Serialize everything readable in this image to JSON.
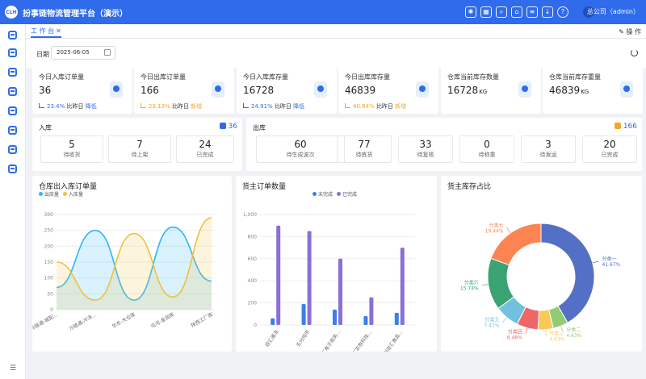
{
  "app": {
    "logo_text": "CLH",
    "title": "扮事链物流管理平台（演示）",
    "user": "总公司（admin）"
  },
  "header_icons": [
    "bug-icon",
    "grid-icon",
    "search-icon",
    "bank-icon",
    "document-icon",
    "download-icon",
    "help-icon"
  ],
  "sidebar": {
    "items": [
      "dashboard-icon",
      "box-icon",
      "truck-icon",
      "package-icon",
      "warehouse-icon",
      "list-icon",
      "report-icon",
      "settings-icon"
    ],
    "collapse_icon": "menu-fold-icon"
  },
  "tabs": [
    {
      "label": "工 作 台",
      "close": "✕"
    }
  ],
  "ops_label": "操 作",
  "filter": {
    "date_label": "日期",
    "date_value": "2025-06-05"
  },
  "stats": [
    {
      "label": "今日入库订单量",
      "value": "36",
      "unit": "",
      "change": "23.4%",
      "compare": "比昨日",
      "status": "降低",
      "color": "#2f6bea",
      "icon": "order-in-icon"
    },
    {
      "label": "今日出库订单量",
      "value": "166",
      "unit": "",
      "change": "23.13%",
      "compare": "比昨日",
      "status": "新增",
      "color": "#f5a623",
      "icon": "order-out-icon"
    },
    {
      "label": "今日入库库存量",
      "value": "16728",
      "unit": "",
      "change": "24.91%",
      "compare": "比昨日",
      "status": "降低",
      "color": "#2f6bea",
      "icon": "stock-in-icon"
    },
    {
      "label": "今日出库库存量",
      "value": "46839",
      "unit": "",
      "change": "40.84%",
      "compare": "比昨日",
      "status": "新增",
      "color": "#f5a623",
      "icon": "stock-out-icon"
    },
    {
      "label": "仓库当前库存数量",
      "value": "16728",
      "unit": "KG",
      "change": "",
      "compare": "",
      "status": "",
      "color": "#2f6bea",
      "icon": "warehouse-qty-icon"
    },
    {
      "label": "仓库当前库存重量",
      "value": "46839",
      "unit": "KG",
      "change": "",
      "compare": "",
      "status": "",
      "color": "#2f6bea",
      "icon": "warehouse-weight-icon"
    }
  ],
  "inbound": {
    "title": "入库",
    "count": "36",
    "items": [
      {
        "value": "5",
        "label": "待收货"
      },
      {
        "value": "7",
        "label": "待上架"
      },
      {
        "value": "24",
        "label": "已完成"
      }
    ]
  },
  "outbound": {
    "title": "出库",
    "count": "166",
    "items": [
      {
        "value": "60",
        "label": "待生成波次"
      },
      {
        "value": "77",
        "label": "待拣货"
      },
      {
        "value": "33",
        "label": "待复核"
      },
      {
        "value": "0",
        "label": "待称重"
      },
      {
        "value": "3",
        "label": "待发运"
      },
      {
        "value": "20",
        "label": "已完成"
      }
    ]
  },
  "chart_data": [
    {
      "type": "area",
      "title": "仓库出入库订单量",
      "categories": [
        "冷链通-城配…",
        "冷链通-冷冻…",
        "华东-大仓库",
        "屯河-金润库",
        "陕西工厂库"
      ],
      "series": [
        {
          "name": "出库量",
          "color": "#2db7f5",
          "values": [
            70,
            250,
            30,
            260,
            90
          ]
        },
        {
          "name": "入库量",
          "color": "#f0c040",
          "values": [
            150,
            30,
            240,
            40,
            290
          ]
        }
      ],
      "ylim": [
        0,
        300
      ],
      "yticks": [
        0,
        50,
        100,
        150,
        200,
        250,
        300
      ],
      "grid": true,
      "legend": "top-left"
    },
    {
      "type": "bar",
      "title": "货主订单数量",
      "categories": [
        "双汇速冻",
        "五分炖市",
        "双汇电子商务…",
        "双汇农牧科技…",
        "郑州双汇食品…"
      ],
      "series": [
        {
          "name": "未完成",
          "color": "#3b7fe8",
          "values": [
            60,
            190,
            140,
            80,
            110
          ]
        },
        {
          "name": "已完成",
          "color": "#8b6fd6",
          "values": [
            900,
            850,
            600,
            250,
            700
          ]
        }
      ],
      "ylim": [
        0,
        1000
      ],
      "yticks": [
        0,
        200,
        400,
        600,
        800,
        1000
      ],
      "ytick_labels": [
        "0",
        "200",
        "400",
        "600",
        "800",
        "1,000"
      ],
      "grid": true,
      "legend": "top"
    },
    {
      "type": "pie",
      "title": "货主库存占比",
      "slices": [
        {
          "name": "分类一",
          "value": 41.67,
          "label": "41.67%",
          "color": "#5470c6"
        },
        {
          "name": "分类二",
          "value": 4.63,
          "label": "4.63%",
          "color": "#91cc75"
        },
        {
          "name": "分类三",
          "value": 4.63,
          "label": "4.63%",
          "color": "#fac858"
        },
        {
          "name": "分类四",
          "value": 6.48,
          "label": "6.48%",
          "color": "#ee6666"
        },
        {
          "name": "分类五",
          "value": 7.41,
          "label": "7.41%",
          "color": "#73c0de"
        },
        {
          "name": "分类六",
          "value": 15.74,
          "label": "15.74%",
          "color": "#3ba272"
        },
        {
          "name": "分类七",
          "value": 19.44,
          "label": "19.44%",
          "color": "#fc8452"
        }
      ]
    }
  ]
}
